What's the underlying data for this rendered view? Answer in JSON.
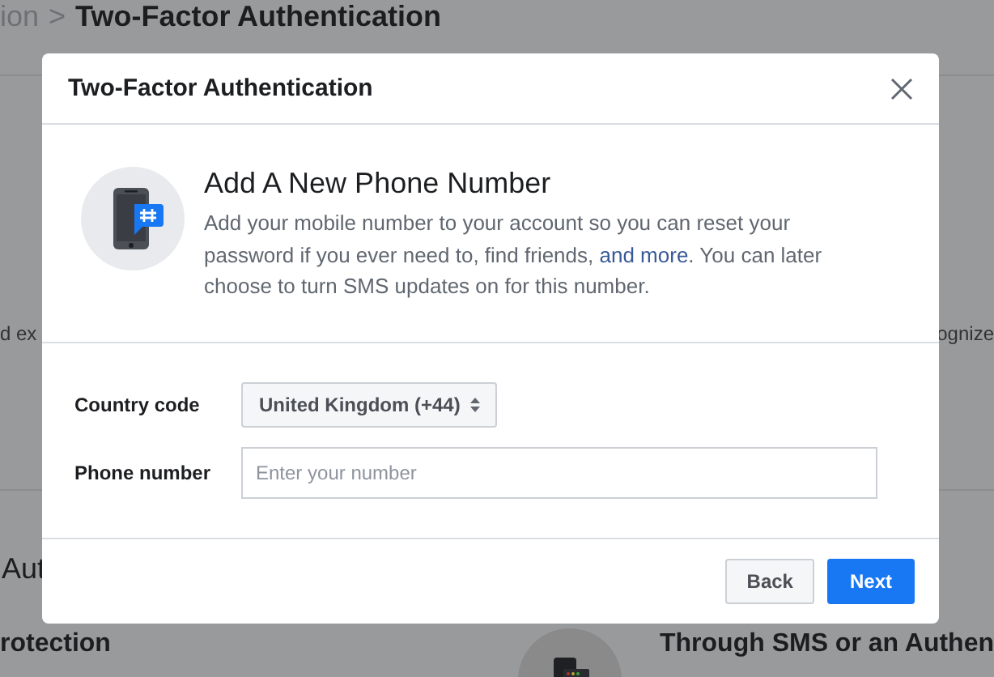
{
  "background_page": {
    "breadcrumb_prefix": "ion",
    "breadcrumb_separator": ">",
    "breadcrumb_current": "Two-Factor Authentication",
    "fragment_left": "d ex",
    "fragment_right": "ognize",
    "section_heading": "Aut",
    "item_left": "rotection",
    "item_right": "Through SMS or an Authen"
  },
  "dialog": {
    "title": "Two-Factor Authentication",
    "heading": "Add A New Phone Number",
    "description_before": "Add your mobile number to your account so you can reset your password if you ever need to, find friends, ",
    "link": "and more",
    "description_after": ". You can later choose to turn SMS updates on for this number.",
    "fields": [
      {
        "kind": "select",
        "label": "Country code",
        "value": "United Kingdom (+44)"
      },
      {
        "kind": "text",
        "label": "Phone number",
        "placeholder": "Enter your number"
      }
    ],
    "buttons": [
      {
        "label": "Back",
        "primary": false
      },
      {
        "label": "Next",
        "primary": true
      }
    ]
  }
}
